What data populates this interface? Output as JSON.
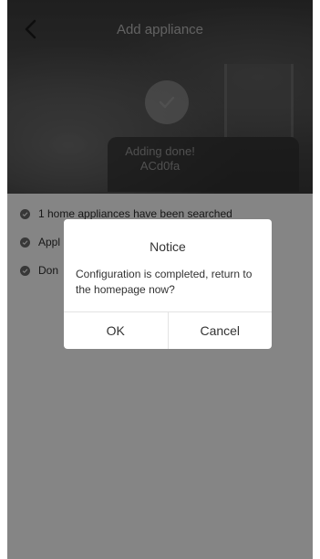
{
  "header": {
    "title": "Add appliance",
    "back_icon": "chevron-left-icon"
  },
  "status": {
    "icon": "checkmark-icon",
    "message": "Adding done!",
    "device_id": "ACd0fa"
  },
  "steps": [
    {
      "label": "1 home appliances have been searched",
      "icon": "check-circle-icon"
    },
    {
      "label": "Appl",
      "icon": "check-circle-icon"
    },
    {
      "label": "Don",
      "icon": "check-circle-icon"
    }
  ],
  "dialog": {
    "title": "Notice",
    "message": "Configuration is completed, return to the homepage now?",
    "ok_label": "OK",
    "cancel_label": "Cancel"
  },
  "colors": {
    "overlay": "#000000",
    "dialog_bg": "#ffffff",
    "step_dot": "#6b6b6b"
  }
}
